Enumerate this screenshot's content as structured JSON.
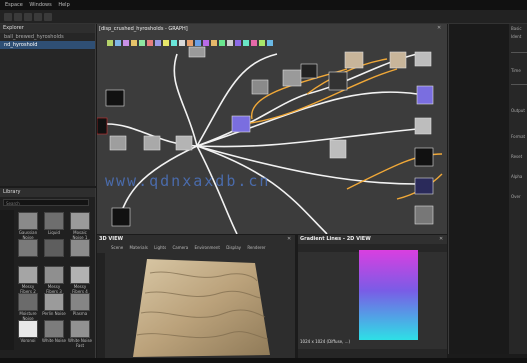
{
  "menubar": {
    "items": [
      "Espace",
      "Windows",
      "Help"
    ]
  },
  "explorer": {
    "title": "Explorer",
    "rows": [
      "ball_brewed_hyrosholds",
      "nd_hyroshold"
    ]
  },
  "library": {
    "title": "Library",
    "search_placeholder": "Search",
    "items": [
      {
        "label": "Gaussian Noise",
        "tone": "#8a8a8a"
      },
      {
        "label": "Liquid",
        "tone": "#6e6e6e"
      },
      {
        "label": "Mosaic Noise 1",
        "tone": "#9a9a9a"
      },
      {
        "label": "",
        "tone": "#7a7a7a"
      },
      {
        "label": "",
        "tone": "#5e5e5e"
      },
      {
        "label": "",
        "tone": "#8c8c8c"
      },
      {
        "label": "Messy Fibers 2",
        "tone": "#a5a5a5"
      },
      {
        "label": "Messy Fibers 3",
        "tone": "#8f8f8f"
      },
      {
        "label": "Messy Fibers 4",
        "tone": "#b2b2b2"
      },
      {
        "label": "Moisture Noise",
        "tone": "#6b6b6b"
      },
      {
        "label": "Perlin Noise",
        "tone": "#9b9b9b"
      },
      {
        "label": "Plasma",
        "tone": "#858585"
      },
      {
        "label": "Voronoi",
        "tone": "#e8e8e8"
      },
      {
        "label": "White Noise",
        "tone": "#7c7c7c"
      },
      {
        "label": "White Noise Fast",
        "tone": "#929292"
      }
    ]
  },
  "graph": {
    "tab_title": "[disp_crushed_hyrosholds - GRAPH]",
    "zoom": "100%",
    "watermark": "www.qdnxaxdb.cn"
  },
  "view3d": {
    "title": "3D VIEW",
    "menu": [
      "Scene",
      "Materials",
      "Lights",
      "Camera",
      "Environment",
      "Display",
      "Renderer"
    ]
  },
  "view2d": {
    "title": "Gradient Lines - 2D VIEW",
    "status": "1024 x 1024 (Diffuse, ...)"
  },
  "props": {
    "labels": [
      "Basic",
      "Ident",
      "",
      "Time",
      "",
      "Output",
      "Format",
      "Reset",
      "Alpha",
      "Over"
    ]
  },
  "colors": {
    "accent_blue": "#2f4f74",
    "wire_yellow": "#f0a838",
    "wire_white": "#f2f2f2",
    "node_purple": "#7a6ee0",
    "gradient_top": "#d93fe0",
    "gradient_bottom": "#2ee0e6"
  }
}
